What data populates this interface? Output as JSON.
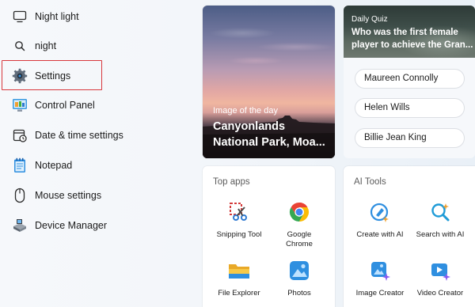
{
  "search_results": [
    {
      "label": "Night light",
      "icon": "monitor-icon"
    },
    {
      "label": "night",
      "icon": "search-icon"
    },
    {
      "label": "Settings",
      "icon": "gear-icon"
    },
    {
      "label": "Control Panel",
      "icon": "control-panel-icon"
    },
    {
      "label": "Date & time settings",
      "icon": "calendar-clock-icon"
    },
    {
      "label": "Notepad",
      "icon": "notepad-icon"
    },
    {
      "label": "Mouse settings",
      "icon": "mouse-icon"
    },
    {
      "label": "Device Manager",
      "icon": "device-manager-icon"
    }
  ],
  "selected_result": "Settings",
  "image_of_the_day": {
    "kicker": "Image of the day",
    "title": "Canyonlands National Park, Moa..."
  },
  "daily_quiz": {
    "kicker": "Daily Quiz",
    "question_line1": "Who was the first female",
    "question_line2": "player to achieve the Gran...",
    "answers": [
      "Maureen Connolly",
      "Helen Wills",
      "Billie Jean King"
    ]
  },
  "top_apps": {
    "title": "Top apps",
    "apps": [
      {
        "label": "Snipping Tool",
        "icon": "snipping-tool-icon"
      },
      {
        "label": "Google Chrome",
        "icon": "chrome-icon"
      },
      {
        "label": "File Explorer",
        "icon": "file-explorer-icon"
      },
      {
        "label": "Photos",
        "icon": "photos-icon"
      }
    ]
  },
  "ai_tools": {
    "title": "AI Tools",
    "tools": [
      {
        "label": "Create with AI",
        "icon": "create-with-ai-icon"
      },
      {
        "label": "Search with AI",
        "icon": "search-with-ai-icon"
      },
      {
        "label": "Image Creator",
        "icon": "image-creator-icon"
      },
      {
        "label": "Video Creator",
        "icon": "video-creator-icon"
      }
    ]
  },
  "colors": {
    "selection_border": "#d8373c",
    "accent_blue": "#0067c0"
  }
}
